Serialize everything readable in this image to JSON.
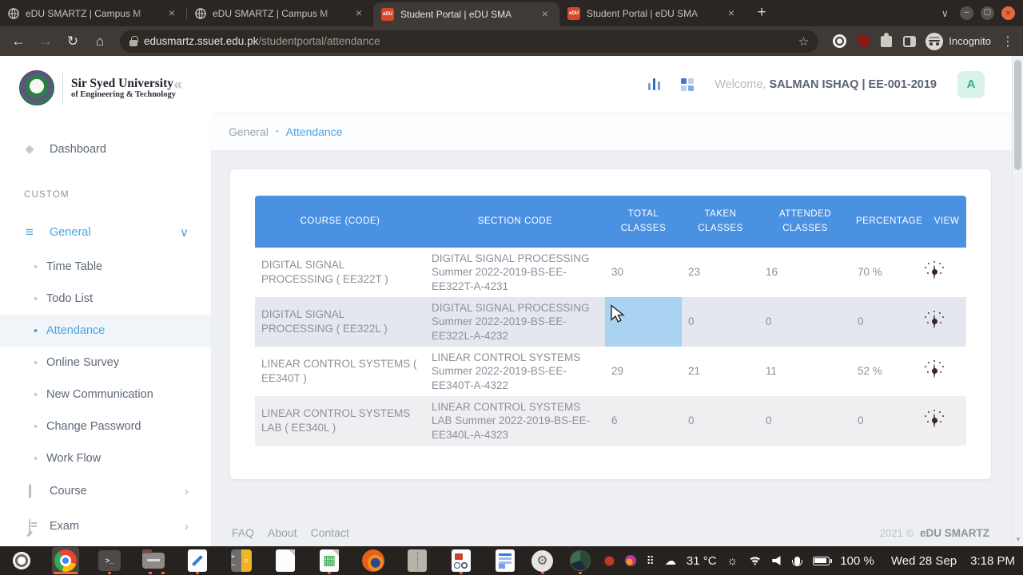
{
  "icons": {
    "back": "←",
    "forward": "→",
    "reload": "↻",
    "home": "⌂",
    "star": "☆",
    "menu": "⋮",
    "new_tab": "+",
    "tab_list_chevron": "∨",
    "close": "×",
    "minimize": "–",
    "maximize": "▢",
    "collapse": "«",
    "chevron_down": "∨",
    "chevron_right": "›",
    "bullet": "•",
    "dot_separator": "•",
    "diamond": "◆",
    "list": "≡",
    "terminal": "&gt;_",
    "terminal_text": ">_",
    "plus": "+",
    "minus": "−",
    "equals": "=",
    "grid_sheet": "▦",
    "cloud": "☁",
    "sun": "☼",
    "dots_grid": "⠿",
    "gear": "⚙",
    "scroll_down": "▼"
  },
  "browser": {
    "tabs": [
      {
        "title": "eDU SMARTZ | Campus M"
      },
      {
        "title": "eDU SMARTZ | Campus M"
      },
      {
        "title": "Student Portal | eDU SMA"
      },
      {
        "title": "Student Portal | eDU SMA"
      }
    ],
    "edu_badge": "eDU",
    "address": {
      "domain": "edusmartz.ssuet.edu.pk",
      "path": "/studentportal/attendance"
    },
    "incognito_label": "Incognito"
  },
  "app": {
    "university_name": "Sir Syed University",
    "university_subtitle": "of Engineering & Technology",
    "welcome_prefix": "Welcome,",
    "user": "SALMAN ISHAQ | EE-001-2019",
    "avatar_letter": "A",
    "breadcrumb": {
      "parent": "General",
      "current": "Attendance"
    }
  },
  "sidebar": {
    "dashboard": "Dashboard",
    "section_label": "CUSTOM",
    "general_label": "General",
    "items": [
      "Time Table",
      "Todo List",
      "Attendance",
      "Online Survey",
      "New Communication",
      "Change Password",
      "Work Flow"
    ],
    "active_item": "Attendance",
    "course_label": "Course",
    "exam_label": "Exam"
  },
  "table": {
    "headers": [
      "COURSE (CODE)",
      "SECTION CODE",
      "TOTAL CLASSES",
      "TAKEN CLASSES",
      "ATTENDED CLASSES",
      "PERCENTAGE",
      "VIEW"
    ],
    "rows": [
      {
        "course": "DIGITAL SIGNAL PROCESSING ( EE322T )",
        "section": "DIGITAL SIGNAL PROCESSING Summer 2022-2019-BS-EE-EE322T-A-4231",
        "total": "30",
        "taken": "23",
        "attended": "16",
        "percentage": "70 %"
      },
      {
        "course": "DIGITAL SIGNAL PROCESSING ( EE322L )",
        "section": "DIGITAL SIGNAL PROCESSING Summer 2022-2019-BS-EE-EE322L-A-4232",
        "total": "",
        "total_highlighted": true,
        "taken": "0",
        "attended": "0",
        "percentage": "0"
      },
      {
        "course": "LINEAR CONTROL SYSTEMS ( EE340T )",
        "section": "LINEAR CONTROL SYSTEMS Summer 2022-2019-BS-EE-EE340T-A-4322",
        "total": "29",
        "taken": "21",
        "attended": "11",
        "percentage": "52 %"
      },
      {
        "course": "LINEAR CONTROL SYSTEMS LAB ( EE340L )",
        "section": "LINEAR CONTROL SYSTEMS LAB Summer 2022-2019-BS-EE-EE340L-A-4323",
        "total": "6",
        "taken": "0",
        "attended": "0",
        "percentage": "0"
      }
    ]
  },
  "footer": {
    "links": [
      "FAQ",
      "About",
      "Contact"
    ],
    "copyright": "2021 ©",
    "brand": "eDU SMARTZ"
  },
  "taskbar": {
    "temperature": "31 °C",
    "battery": "100 %",
    "date": "Wed 28 Sep",
    "time": "3:18 PM"
  },
  "colors": {
    "accent_blue": "#4aa3df",
    "table_header": "#4b91e2",
    "selection": "#a9d3f1",
    "avatar_bg": "#d8f3e9",
    "avatar_text": "#2fae93",
    "taskbar_indicator": "#e8683f"
  }
}
